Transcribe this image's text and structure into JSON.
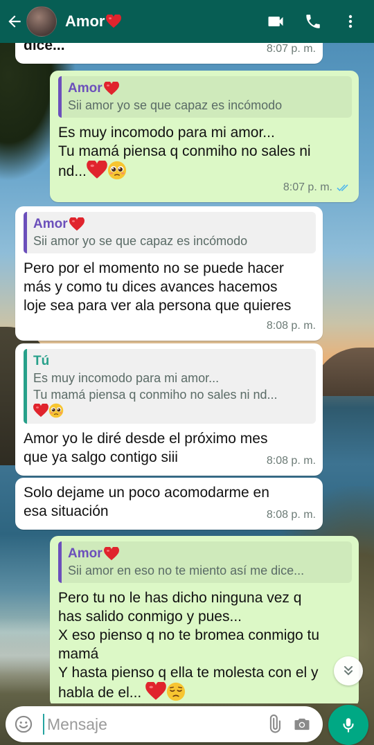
{
  "header": {
    "contact_name": "Amor",
    "colors": {
      "bar": "#075e54",
      "heart": "#e0242d"
    }
  },
  "messages": [
    {
      "id": "m1",
      "direction": "in",
      "text": "dice...",
      "time": "8:07 p. m."
    },
    {
      "id": "m2",
      "direction": "out",
      "quote_author": "Amor",
      "quote_text": "Sii amor yo se que capaz es incómodo",
      "text_line1": "Es muy incomodo para mi amor...",
      "text_line2": "Tu mamá piensa q conmiho no sales ni",
      "text_line3": "nd...",
      "time": "8:07 p. m.",
      "status": "read-double-check"
    },
    {
      "id": "m3",
      "direction": "in",
      "quote_author": "Amor",
      "quote_text": "Sii amor yo se que capaz es incómodo",
      "text": "Pero por el momento no se puede hacer\nmás y como tu dices avances hacemos\nloje sea para ver ala persona que quieres",
      "time": "8:08 p. m."
    },
    {
      "id": "m4",
      "direction": "in",
      "quote_author": "Tú",
      "quote_text_line1": "Es muy incomodo para mi amor...",
      "quote_text_line2": "Tu mamá piensa q conmiho no sales ni nd...",
      "text": "Amor yo le diré desde el próximo mes\nque ya salgo contigo siii",
      "time": "8:08 p. m."
    },
    {
      "id": "m5",
      "direction": "in",
      "text": "Solo dejame un poco acomodarme en\nesa situación",
      "time": "8:08 p. m."
    },
    {
      "id": "m6",
      "direction": "out",
      "quote_author": "Amor",
      "quote_text": "Sii amor en eso no te miento así me dice...",
      "text": "Pero tu no le has dicho ninguna vez q\nhas salido conmigo y pues...\nX eso pienso q no te bromea conmigo tu\nmamá\nY hasta pienso q ella te molesta con el y\nhabla de el..."
    }
  ],
  "composer": {
    "placeholder": "Mensaje"
  },
  "icons": {
    "back": "arrow-left-icon",
    "video": "video-camera-icon",
    "call": "phone-icon",
    "menu": "more-vertical-icon",
    "emoji": "emoji-icon",
    "attach": "paperclip-icon",
    "camera": "camera-icon",
    "mic": "microphone-icon",
    "scroll": "double-chevron-down-icon"
  }
}
